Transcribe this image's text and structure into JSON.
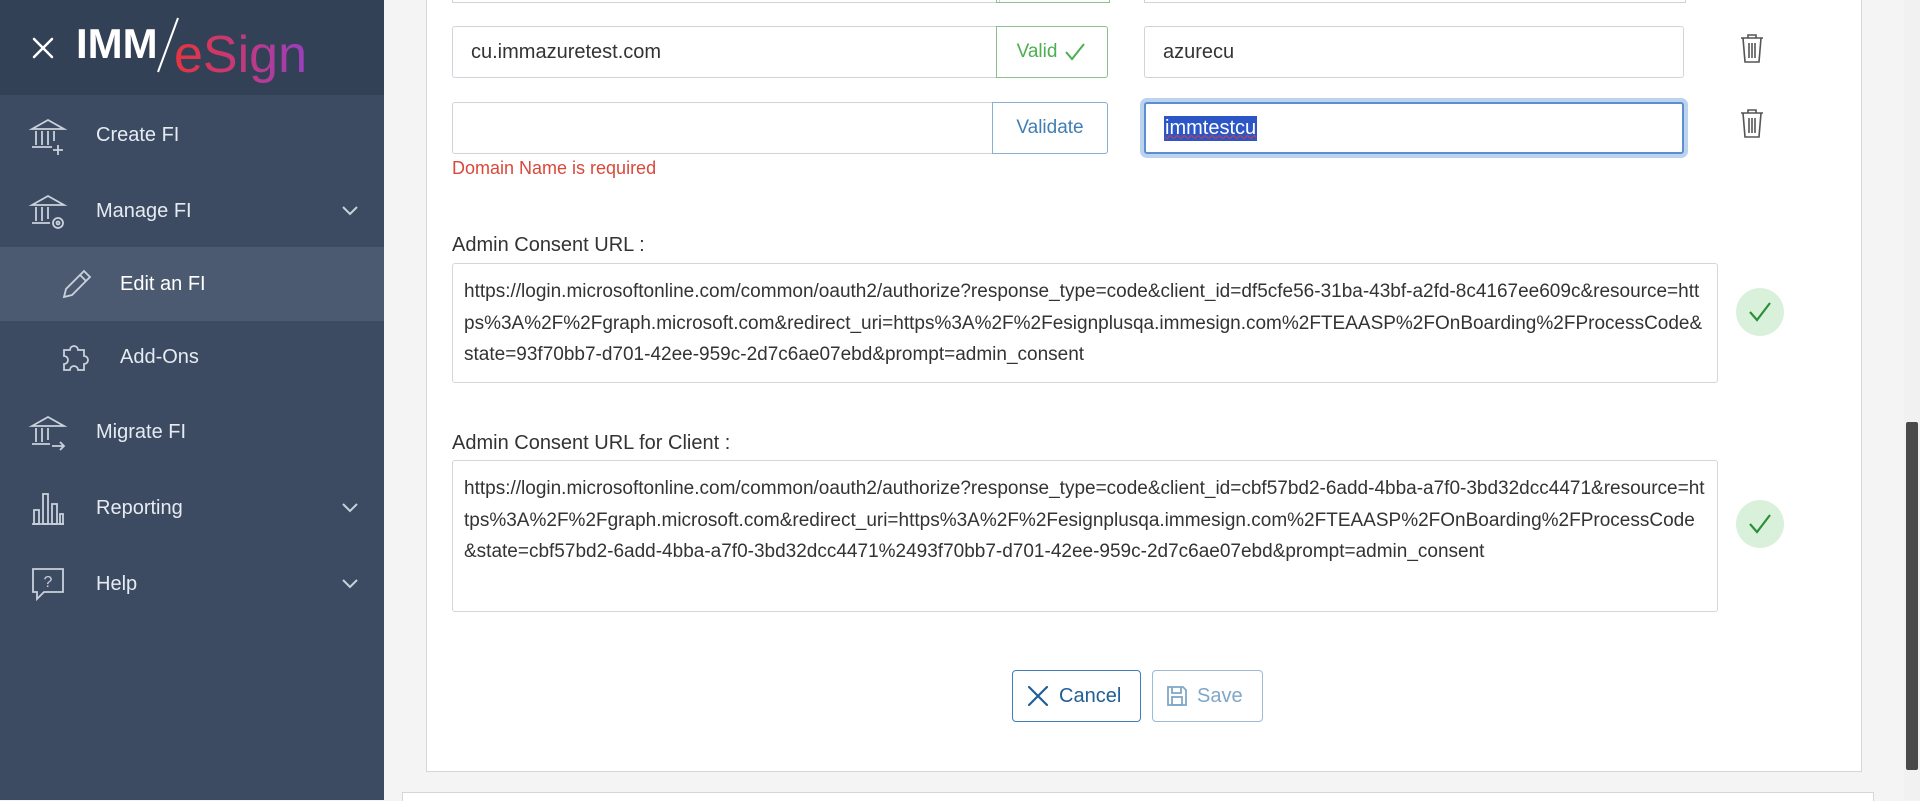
{
  "brand": {
    "imm": "IMM",
    "esign": "eSign"
  },
  "nav": {
    "create_fi": "Create FI",
    "manage_fi": "Manage FI",
    "edit_fi": "Edit an FI",
    "add_ons": "Add-Ons",
    "migrate_fi": "Migrate FI",
    "reporting": "Reporting",
    "help": "Help"
  },
  "domains": [
    {
      "domain": "cu.immazuretest.com",
      "status": "Valid",
      "tenant": "azurecu"
    },
    {
      "domain": "",
      "status": "Validate",
      "tenant": "immtestcu",
      "error": "Domain Name is required"
    }
  ],
  "admin_consent": {
    "label": "Admin Consent URL :",
    "url": "https://login.microsoftonline.com/common/oauth2/authorize?response_type=code&client_id=df5cfe56-31ba-43bf-a2fd-8c4167ee609c&resource=https%3A%2F%2Fgraph.microsoft.com&redirect_uri=https%3A%2F%2Fesignplusqa.immesign.com%2FTEAASP%2FOnBoarding%2FProcessCode&state=93f70bb7-d701-42ee-959c-2d7c6ae07ebd&prompt=admin_consent"
  },
  "admin_consent_client": {
    "label": "Admin Consent URL for Client :",
    "url": "https://login.microsoftonline.com/common/oauth2/authorize?response_type=code&client_id=cbf57bd2-6add-4bba-a7f0-3bd32dcc4471&resource=https%3A%2F%2Fgraph.microsoft.com&redirect_uri=https%3A%2F%2Fesignplusqa.immesign.com%2FTEAASP%2FOnBoarding%2FProcessCode&state=cbf57bd2-6add-4bba-a7f0-3bd32dcc4471%2493f70bb7-d701-42ee-959c-2d7c6ae07ebd&prompt=admin_consent"
  },
  "buttons": {
    "cancel": "Cancel",
    "save": "Save"
  },
  "colors": {
    "sidebar": "#3c4b62",
    "accent": "#3f7fb5",
    "valid": "#4caf50",
    "error": "#d9483b"
  },
  "icons": [
    "close-icon",
    "bank-plus-icon",
    "bank-gear-icon",
    "pencil-icon",
    "puzzle-icon",
    "bank-arrow-icon",
    "bar-chart-icon",
    "help-bubble-icon",
    "trash-icon",
    "check-icon",
    "x-icon",
    "save-icon"
  ]
}
